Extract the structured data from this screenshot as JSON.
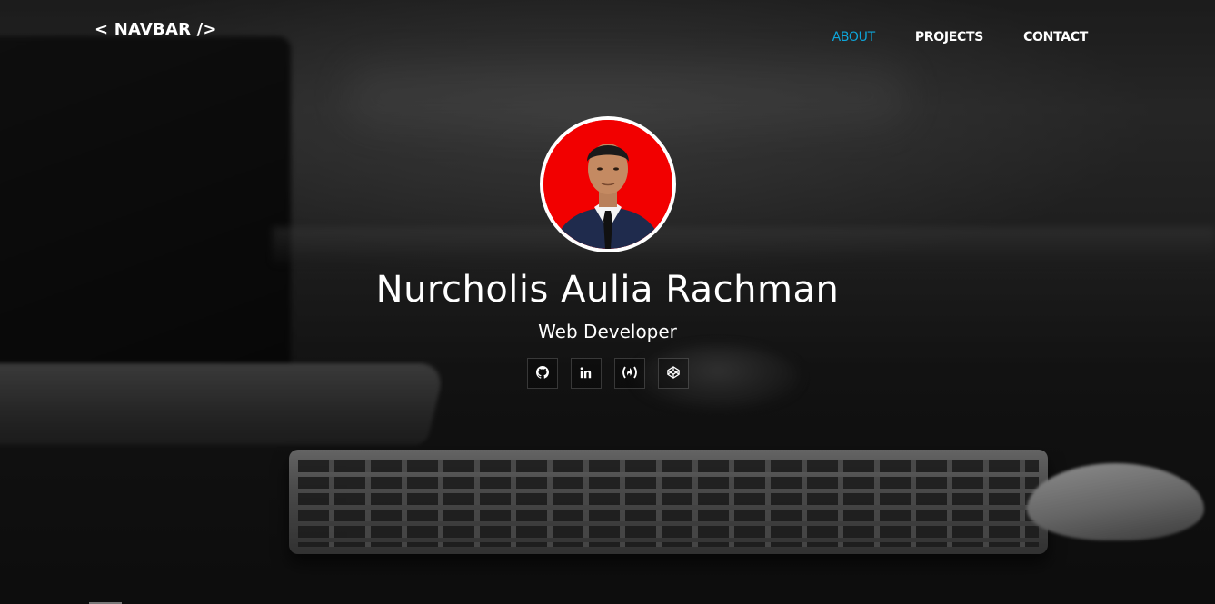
{
  "navbar": {
    "brand": "< NAVBAR />",
    "links": [
      {
        "label": "ABOUT",
        "active": true
      },
      {
        "label": "PROJECTS",
        "active": false
      },
      {
        "label": "CONTACT",
        "active": false
      }
    ]
  },
  "profile": {
    "name": "Nurcholis Aulia Rachman",
    "role": "Web Developer",
    "avatar_icon": "profile-photo"
  },
  "socials": [
    {
      "icon": "github-icon"
    },
    {
      "icon": "linkedin-icon"
    },
    {
      "icon": "freecodecamp-icon"
    },
    {
      "icon": "codepen-icon"
    }
  ],
  "colors": {
    "accent": "#0ea5d9",
    "text": "#ffffff",
    "avatar_background": "#f20000"
  }
}
